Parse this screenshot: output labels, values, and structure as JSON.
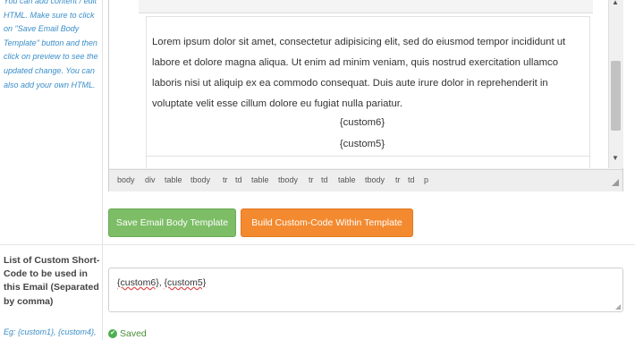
{
  "help": {
    "text": "You can add content / edit HTML. Make sure to click on \"Save Email Body Template\" button and then click on preview to see the updated change. You can also add your own HTML.",
    "example": "Eg: {custom1}, {custom4},"
  },
  "editor": {
    "paragraph": "Lorem ipsum dolor sit amet, consectetur adipisicing elit, sed do eiusmod tempor incididunt ut labore et dolore magna aliqua. Ut enim ad minim veniam, quis nostrud exercitation ullamco laboris nisi ut aliquip ex ea commodo consequat. Duis aute irure dolor in reprehenderit in voluptate velit esse cillum dolore eu fugiat nulla pariatur.",
    "code_lines": [
      "{custom6}",
      "{custom5}"
    ],
    "path": [
      "body",
      "div",
      "table",
      "tbody",
      "tr",
      "td",
      "table",
      "tbody",
      "tr",
      "td",
      "table",
      "tbody",
      "tr",
      "td",
      "p"
    ]
  },
  "buttons": {
    "save": "Save Email Body Template",
    "build": "Build Custom-Code Within Template"
  },
  "shortcode": {
    "label": "List of Custom Short-Code to be used in this Email (Separated by comma)",
    "value_parts": [
      "{custom6}",
      ", ",
      "{custom5}"
    ]
  },
  "status": {
    "saved": "Saved",
    "icon": "check-icon"
  },
  "colors": {
    "save_button": "#7cbd66",
    "build_button": "#f38a30",
    "help_text": "#3a8ec9",
    "saved_text": "#4a8f3a"
  }
}
